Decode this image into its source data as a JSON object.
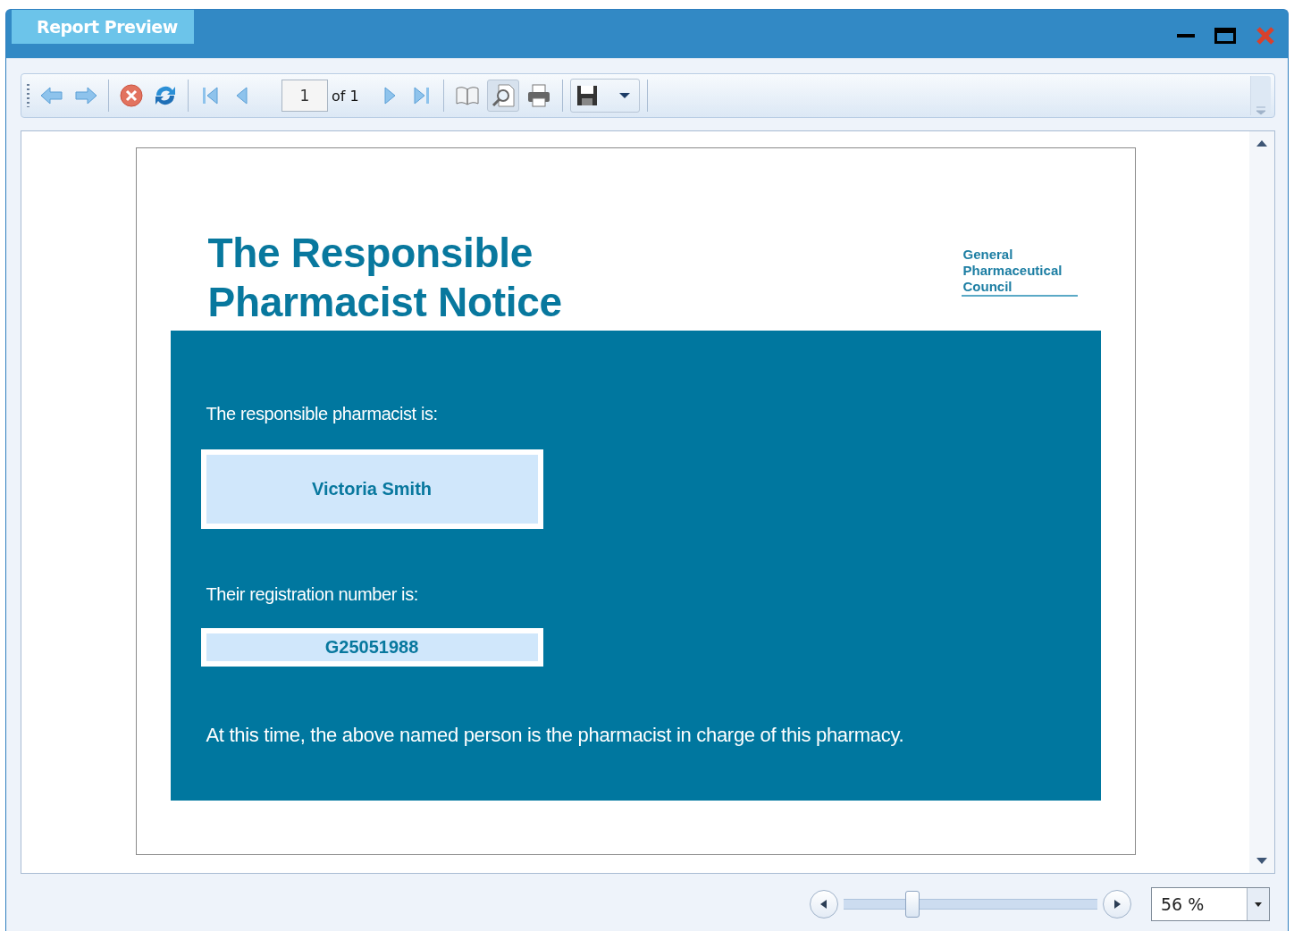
{
  "window": {
    "title": "Report Preview"
  },
  "toolbar": [
    {
      "kind": "back",
      "pressed": false
    },
    {
      "kind": "forward",
      "pressed": false
    },
    {
      "kind": "separator"
    },
    {
      "kind": "stop",
      "pressed": false
    },
    {
      "kind": "refresh",
      "pressed": false
    },
    {
      "kind": "separator"
    },
    {
      "kind": "first",
      "pressed": false
    },
    {
      "kind": "previous",
      "pressed": false
    },
    {
      "kind": "page",
      "value": "1",
      "total": "of 1"
    },
    {
      "kind": "next",
      "pressed": false
    },
    {
      "kind": "last",
      "pressed": false
    },
    {
      "kind": "separator"
    },
    {
      "kind": "book",
      "pressed": false
    },
    {
      "kind": "find",
      "pressed": true
    },
    {
      "kind": "print",
      "pressed": false
    },
    {
      "kind": "separator"
    },
    {
      "kind": "save",
      "pressed": false
    },
    {
      "kind": "separator"
    }
  ],
  "report": {
    "title_lines": [
      "The Responsible",
      "Pharmacist Notice"
    ],
    "logo_lines": [
      "General",
      "Pharmaceutical",
      "Council"
    ],
    "pharmacist_label": "The responsible pharmacist is:",
    "pharmacist_name": "Victoria Smith",
    "registration_label": "Their registration number is:",
    "registration_number": "G25051988",
    "statement": "At this time, the above named person is the pharmacist in charge of this pharmacy."
  },
  "zoom": {
    "level": 0.27,
    "value": "56 %"
  }
}
